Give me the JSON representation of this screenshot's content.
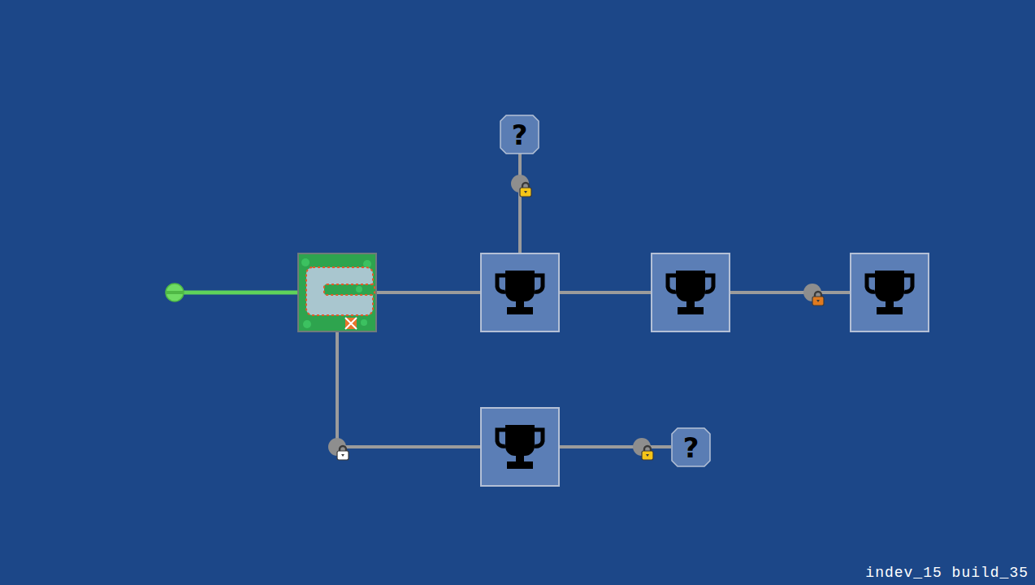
{
  "nodes": [
    {
      "kind": "start"
    },
    {
      "kind": "track"
    },
    {
      "kind": "trophy"
    },
    {
      "kind": "mystery",
      "label": "?"
    },
    {
      "kind": "trophy"
    },
    {
      "kind": "trophy"
    },
    {
      "kind": "trophy"
    },
    {
      "kind": "mystery",
      "label": "?"
    }
  ],
  "paths": [
    {
      "unlocked": true,
      "locked": false
    },
    {
      "unlocked": false,
      "locked": false
    },
    {
      "unlocked": false,
      "locked": true,
      "color": "#f5c518"
    },
    {
      "unlocked": false,
      "locked": false
    },
    {
      "unlocked": false,
      "locked": true,
      "color": "#e07a1f"
    },
    {
      "unlocked": false,
      "locked": true,
      "color": "#ffffff"
    },
    {
      "unlocked": false,
      "locked": true,
      "color": "#f5c518"
    }
  ],
  "version": "indev_15 build_35"
}
